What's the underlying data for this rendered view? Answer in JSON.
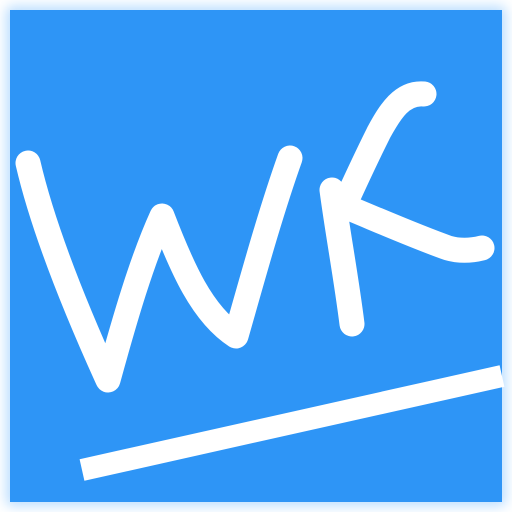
{
  "logo": {
    "text": "WK",
    "background_color": "#2E95F6",
    "foreground_color": "#FFFFFF",
    "glow_color": "#FFFFFF"
  }
}
